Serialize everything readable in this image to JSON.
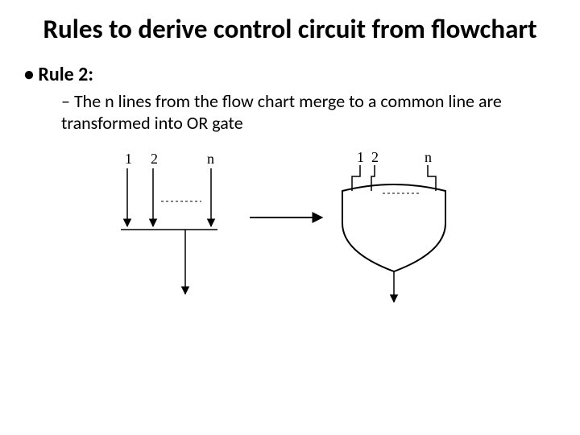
{
  "title": "Rules to derive control circuit from flowchart",
  "bullets": {
    "rule_heading": "Rule 2:",
    "rule_body": "The n lines from the flow chart merge to a common line are transformed into OR gate"
  },
  "diagram": {
    "left_inputs": {
      "a": "1",
      "b": "2",
      "c": "n"
    },
    "right_inputs": {
      "a": "1",
      "b": "2",
      "c": "n"
    }
  }
}
